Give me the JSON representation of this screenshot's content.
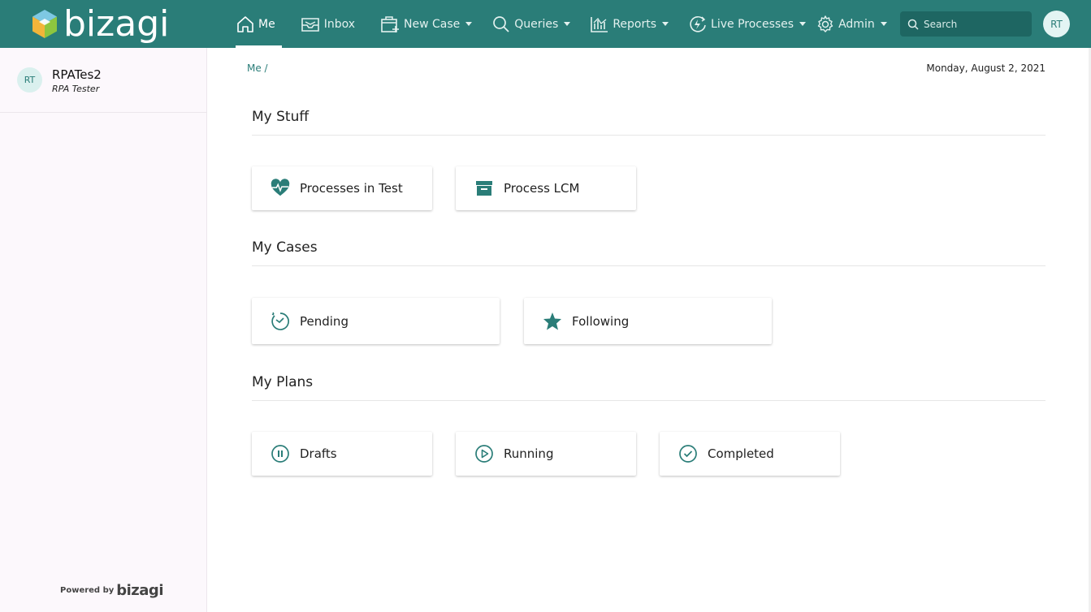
{
  "topbar": {
    "logo_text": "bizagi",
    "nav": [
      {
        "label": "Me",
        "icon": "home-icon",
        "active": true,
        "dropdown": false
      },
      {
        "label": "Inbox",
        "icon": "inbox-icon",
        "active": false,
        "dropdown": false
      },
      {
        "label": "New Case",
        "icon": "new-case-icon",
        "active": false,
        "dropdown": true
      },
      {
        "label": "Queries",
        "icon": "search-icon",
        "active": false,
        "dropdown": true
      },
      {
        "label": "Reports",
        "icon": "chart-icon",
        "active": false,
        "dropdown": true
      },
      {
        "label": "Live Processes",
        "icon": "lightning-icon",
        "active": false,
        "dropdown": true
      },
      {
        "label": "Admin",
        "icon": "gear-icon",
        "active": false,
        "dropdown": true
      }
    ],
    "search_placeholder": "Search",
    "avatar_initials": "RT",
    "bar_color": "#2a7d78"
  },
  "sidebar": {
    "avatar_initials": "RT",
    "user_name": "RPATes2",
    "user_role": "RPA Tester",
    "powered_by": "Powered by",
    "powered_brand": "bizagi"
  },
  "main": {
    "breadcrumb": "Me /",
    "date": "Monday, August 2, 2021",
    "sections": {
      "stuff": {
        "title": "My Stuff",
        "cards": [
          {
            "label": "Processes in Test",
            "icon": "heart-pulse-icon"
          },
          {
            "label": "Process LCM",
            "icon": "archive-box-icon"
          }
        ]
      },
      "cases": {
        "title": "My Cases",
        "cards": [
          {
            "label": "Pending",
            "icon": "timer-icon"
          },
          {
            "label": "Following",
            "icon": "star-icon"
          }
        ]
      },
      "plans": {
        "title": "My Plans",
        "cards": [
          {
            "label": "Drafts",
            "icon": "pause-circle-icon"
          },
          {
            "label": "Running",
            "icon": "play-circle-icon"
          },
          {
            "label": "Completed",
            "icon": "check-circle-icon"
          }
        ]
      }
    }
  }
}
